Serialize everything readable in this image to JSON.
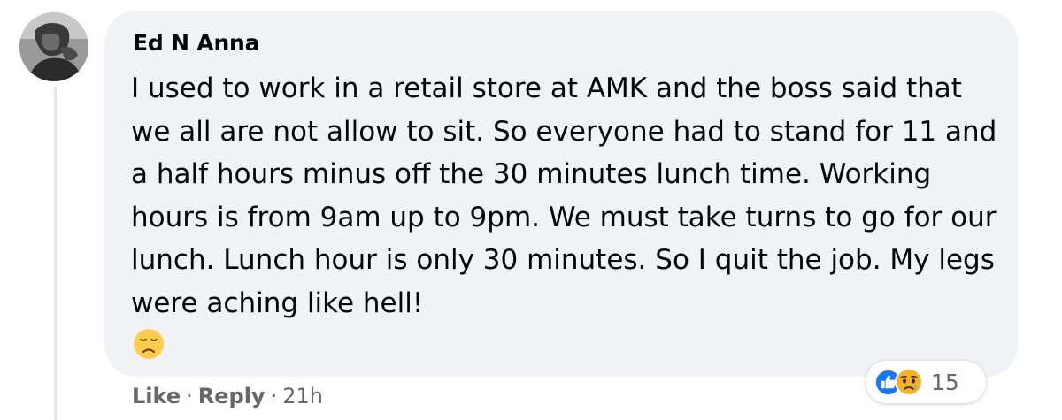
{
  "comment": {
    "author": "Ed N Anna",
    "text": "I used to work in a retail store at AMK and the boss said that we all are not allow to sit. So everyone had to stand for 11 and a half hours minus off the 30 minutes lunch time. Working hours is from 9am up to 9pm. We must take turns to go for our lunch. Lunch hour is only 30 minutes. So I quit the job. My legs were aching like hell!",
    "emoji": "disappointed-face-icon"
  },
  "reactions": {
    "icons": [
      "like-icon",
      "sad-icon"
    ],
    "count": "15"
  },
  "actions": {
    "like_label": "Like",
    "reply_label": "Reply",
    "separator": "·",
    "timestamp": "21h"
  },
  "colors": {
    "bubble": "#f0f2f5",
    "text": "#050505",
    "secondary": "#65676b",
    "like_blue": "#1877f2",
    "sad_yellow": "#f7b125"
  }
}
